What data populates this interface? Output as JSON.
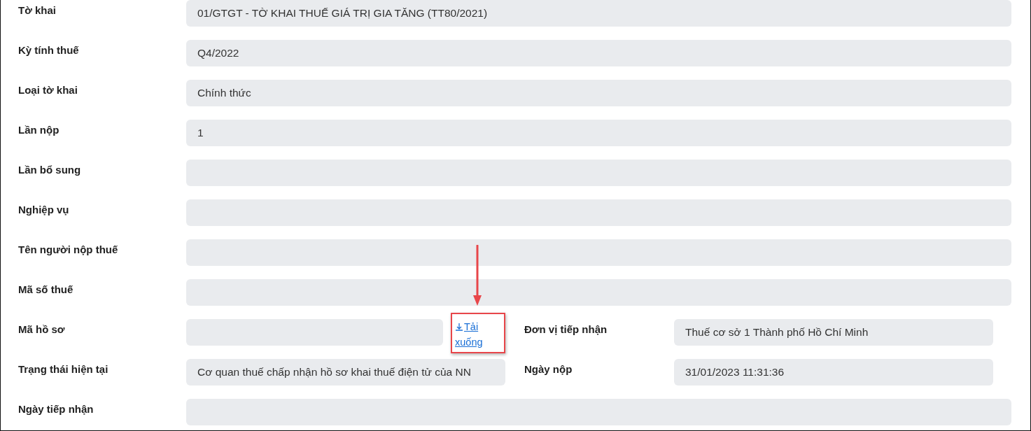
{
  "rows": [
    {
      "kind": "full",
      "label": "Tờ khai",
      "value": "01/GTGT - TỜ KHAI THUẾ GIÁ TRỊ GIA TĂNG (TT80/2021)"
    },
    {
      "kind": "full",
      "label": "Kỳ tính thuế",
      "value": "Q4/2022"
    },
    {
      "kind": "full",
      "label": "Loại tờ khai",
      "value": "Chính thức"
    },
    {
      "kind": "full",
      "label": "Lần nộp",
      "value": "1"
    },
    {
      "kind": "full",
      "label": "Lần bổ sung"
    },
    {
      "kind": "full",
      "label": "Nghiệp vụ"
    },
    {
      "kind": "full",
      "label": "Tên người nộp thuế"
    },
    {
      "kind": "full",
      "label": "Mã số thuế"
    },
    {
      "kind": "split",
      "label": "Mã hồ sơ",
      "link": "Tải xuống",
      "right_label": "Đơn vị tiếp nhận",
      "right_value": "Thuế cơ sở 1 Thành phố Hồ Chí Minh"
    },
    {
      "kind": "split",
      "label": "Trạng thái hiện tại",
      "value": "Cơ quan thuế chấp nhận hồ sơ khai thuế điện tử của NN",
      "right_label": "Ngày nộp",
      "right_value": "31/01/2023 11:31:36"
    },
    {
      "kind": "full",
      "label": "Ngày tiếp nhận"
    }
  ]
}
